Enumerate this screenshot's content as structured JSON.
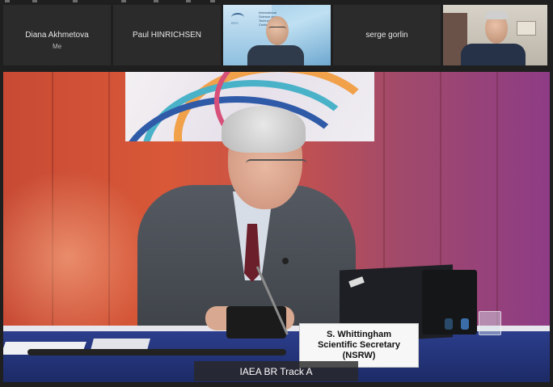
{
  "participants": [
    {
      "name": "Diana Akhmetova",
      "subtitle": "Me",
      "video": false
    },
    {
      "name": "Paul HINRICHSEN",
      "subtitle": "",
      "video": false
    },
    {
      "name": "",
      "subtitle": "",
      "video": true,
      "background_text": "International Science and Technology Center",
      "logo_text": "ISTC"
    },
    {
      "name": "serge gorlin",
      "subtitle": "",
      "video": false
    },
    {
      "name": "",
      "subtitle": "",
      "video": true
    }
  ],
  "main_video": {
    "caption": "IAEA BR Track A",
    "nameplate": {
      "line1": "S. Whittingham",
      "line2": "Scientific Secretary",
      "line3": "(NSRW)"
    }
  },
  "colors": {
    "tile_bg": "#2b2b2b",
    "app_bg": "#1f1f1f",
    "table_blue": "#2c3e8c"
  }
}
